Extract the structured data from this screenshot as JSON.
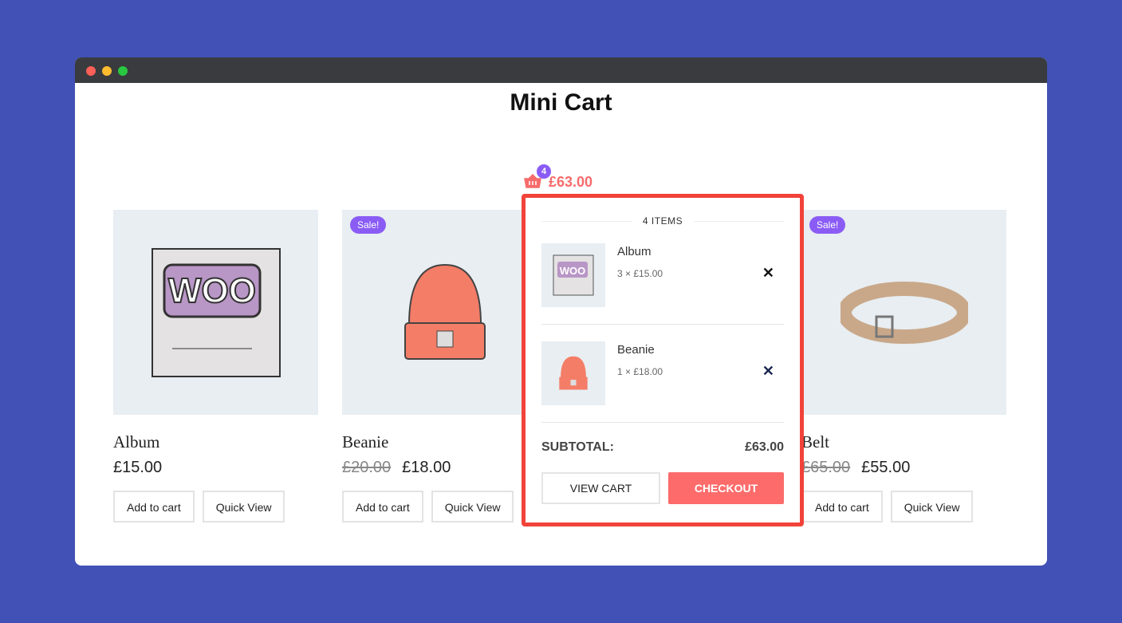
{
  "window": {
    "controls": [
      "close",
      "minimize",
      "maximize"
    ]
  },
  "page_title": "Mini Cart",
  "cart": {
    "count": "4",
    "total": "£63.00",
    "icon": "basket-icon"
  },
  "products": [
    {
      "name": "Album",
      "price": "£15.00",
      "old_price": null,
      "sale": null,
      "add": "Add to cart",
      "quick": "Quick View"
    },
    {
      "name": "Beanie",
      "price": "£18.00",
      "old_price": "£20.00",
      "sale": "Sale!",
      "add": "Add to cart",
      "quick": "Quick View"
    },
    {
      "name": "Belt",
      "price": "£55.00",
      "old_price": "£65.00",
      "sale": "Sale!",
      "add": "Add to cart",
      "quick": "Quick View"
    }
  ],
  "mini_cart": {
    "items_label": "4 ITEMS",
    "items": [
      {
        "name": "Album",
        "qty": "3 × £15.00"
      },
      {
        "name": "Beanie",
        "qty": "1 × £18.00"
      }
    ],
    "subtotal_label": "SUBTOTAL:",
    "subtotal": "£63.00",
    "view_cart": "VIEW CART",
    "checkout": "CHECKOUT"
  },
  "colors": {
    "background": "#4151b6",
    "accent": "#fd6b6b",
    "badge": "#8a5cf5",
    "highlight": "#f2433a"
  }
}
